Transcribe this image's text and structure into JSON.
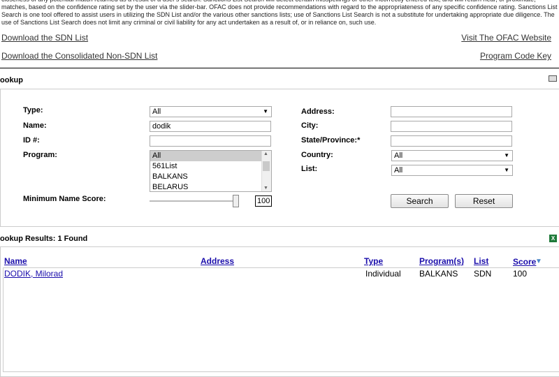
{
  "disclaimer": {
    "text": "closeness of any potential match returned as a result of a user's search. Sanctions List Search will detect certain misspellings or other incorrectly entered text, and will return near, or proximate, matches, based on the confidence rating set by the user via the slider-bar. OFAC does not provide recommendations with regard to the appropriateness of any specific confidence rating. Sanctions List Search is one tool offered to assist users in utilizing the SDN List and/or the various other sanctions lists; use of Sanctions List Search is not a substitute for undertaking appropriate due diligence. The use of Sanctions List Search does not limit any criminal or civil liability for any act undertaken as a result of, or in reliance on, such use."
  },
  "links": {
    "download_sdn": "Download the SDN List",
    "download_consolidated": "Download the Consolidated Non-SDN List",
    "visit_ofac": "Visit The OFAC Website",
    "program_code_key": "Program Code Key"
  },
  "lookup": {
    "title": "ookup",
    "type_label": "Type:",
    "type_value": "All",
    "name_label": "Name:",
    "name_value": "dodik",
    "id_label": "ID #:",
    "id_value": "",
    "program_label": "Program:",
    "program_options": [
      "All",
      "561List",
      "BALKANS",
      "BELARUS"
    ],
    "address_label": "Address:",
    "address_value": "",
    "city_label": "City:",
    "city_value": "",
    "state_label": "State/Province:*",
    "state_value": "",
    "country_label": "Country:",
    "country_value": "All",
    "list_label": "List:",
    "list_value": "All",
    "min_score_label": "Minimum Name Score:",
    "min_score_value": "100",
    "search_button": "Search",
    "reset_button": "Reset"
  },
  "results": {
    "title": "ookup Results: 1 Found",
    "columns": {
      "name": "Name",
      "address": "Address",
      "type": "Type",
      "programs": "Program(s)",
      "list": "List",
      "score": "Score"
    },
    "rows": [
      {
        "name": "DODIK, Milorad",
        "address": "",
        "type": "Individual",
        "programs": "BALKANS",
        "list": "SDN",
        "score": "100"
      }
    ]
  },
  "icons": {
    "print": "printer-icon",
    "excel": "excel-icon",
    "sort": "sort-down-icon"
  }
}
